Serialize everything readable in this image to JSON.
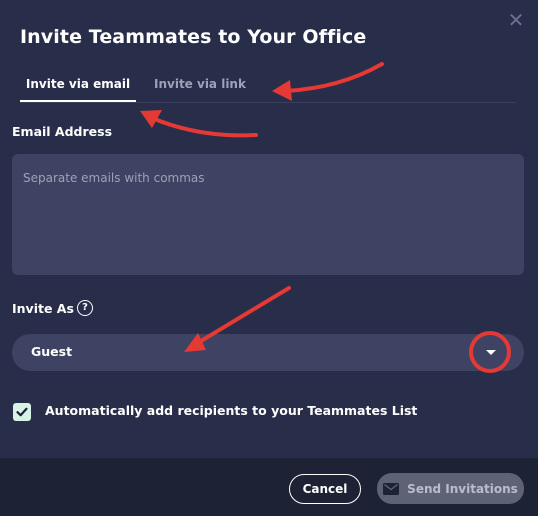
{
  "dialog": {
    "title": "Invite Teammates to Your Office",
    "close_symbol": "✕"
  },
  "tabs": [
    {
      "label": "Invite via email",
      "active": true
    },
    {
      "label": "Invite via link",
      "active": false
    }
  ],
  "email": {
    "label": "Email Address",
    "placeholder": "Separate emails with commas",
    "value": ""
  },
  "invite_as": {
    "label": "Invite As",
    "help_symbol": "?",
    "selected": "Guest"
  },
  "auto_add": {
    "label": "Automatically add recipients to your Teammates List",
    "checked": true
  },
  "footer": {
    "cancel_label": "Cancel",
    "send_label": "Send Invitations"
  },
  "colors": {
    "background": "#282d49",
    "field": "#3e4363",
    "annotation": "#e53935",
    "checkbox": "#d7f3e7"
  }
}
